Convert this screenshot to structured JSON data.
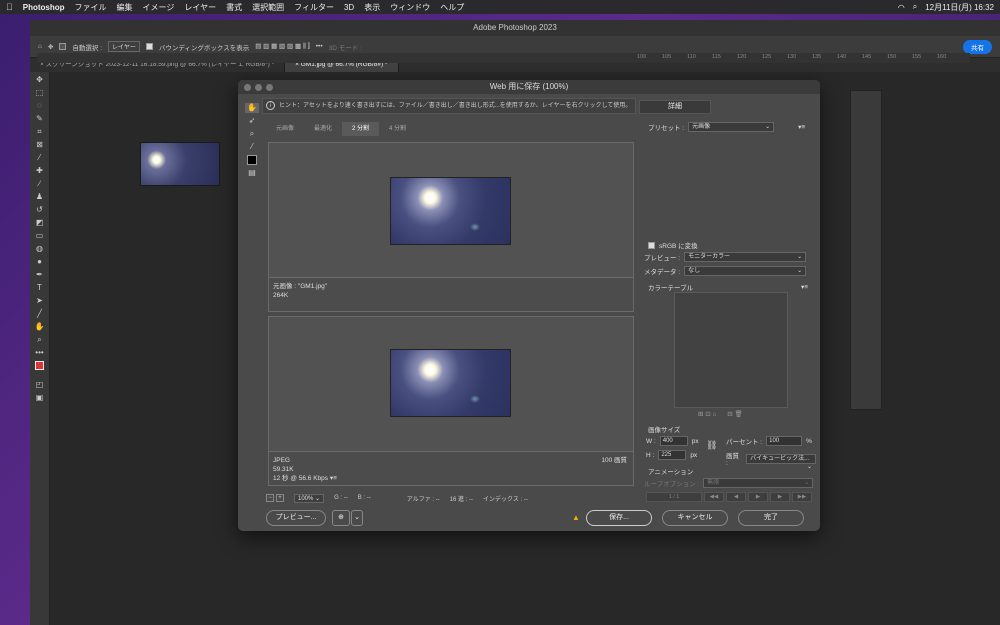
{
  "menubar": {
    "app": "Photoshop",
    "items": [
      "ファイル",
      "編集",
      "イメージ",
      "レイヤー",
      "書式",
      "選択範囲",
      "フィルター",
      "3D",
      "表示",
      "ウィンドウ",
      "ヘルプ"
    ],
    "datetime": "12月11日(月)  16:32"
  },
  "window": {
    "title": "Adobe Photoshop 2023"
  },
  "options": {
    "auto_select": "自動選択 :",
    "layer": "レイヤー",
    "bbox": "バウンディングボックスを表示",
    "mode3d": "3D モード :",
    "share": "共有"
  },
  "doc_tabs": [
    {
      "label": "スクリーンショット 2023-12-11 16.18.59.png @ 66.7% (レイヤー 1, RGB/8*) *"
    },
    {
      "label": "GM1.jpg @ 66.7% (RGB/8#) *"
    }
  ],
  "ruler": [
    "100",
    "105",
    "110",
    "115",
    "120",
    "125",
    "130",
    "135",
    "140",
    "145",
    "150",
    "155",
    "160"
  ],
  "dialog": {
    "title": "Web 用に保存 (100%)",
    "hint": "ヒント：アセットをより速く書き出すには、ファイル／書き出し／書き出し形式...を使用するか、レイヤーを右クリックして使用。",
    "detail": "詳細",
    "tabs": [
      "元画像",
      "最適化",
      "2 分割",
      "4 分割"
    ],
    "pane1": {
      "line1": "元画像 : \"GM1.jpg\"",
      "line2": "264K"
    },
    "pane2": {
      "line1": "JPEG",
      "line2": "59.31K",
      "line3": "12 秒 @ 56.6 Kbps",
      "quality": "100 画質"
    },
    "zoom": "100%",
    "readouts": [
      "G : --",
      "B : --",
      "アルファ : --",
      "16 進 : --",
      "インデックス : --"
    ],
    "preview_btn": "プレビュー...",
    "save_btn": "保存...",
    "cancel_btn": "キャンセル",
    "done_btn": "完了",
    "preset_label": "プリセット :",
    "preset_value": "元画像",
    "srgb": "sRGB に変換",
    "preview_label": "プレビュー :",
    "preview_value": "モニターカラー",
    "meta_label": "メタデータ :",
    "meta_value": "なし",
    "color_table": "カラーテーブル",
    "image_size": "画像サイズ",
    "w_label": "W :",
    "w_value": "400",
    "h_label": "H :",
    "h_value": "225",
    "px": "px",
    "percent_label": "パーセント :",
    "percent_value": "100",
    "percent_unit": "%",
    "quality_label": "画質 :",
    "quality_value": "バイキュービック法...",
    "animation": "アニメーション",
    "loop_label": "ループオプション :",
    "loop_value": "無限",
    "frame": "1 / 1"
  }
}
